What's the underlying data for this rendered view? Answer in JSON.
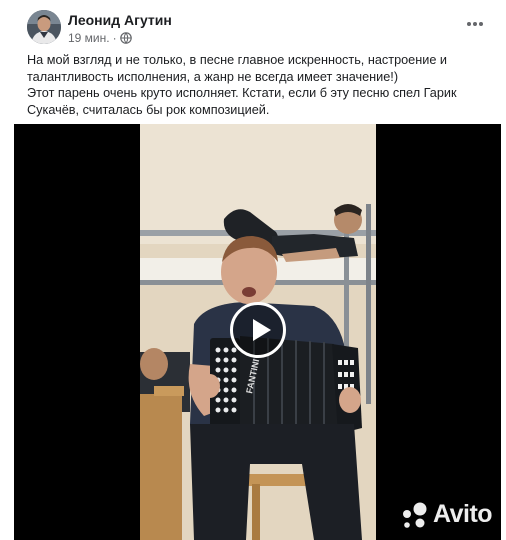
{
  "post": {
    "author": "Леонид Агутин",
    "time": "19 мин.",
    "separator": "·",
    "more_icon": "more-horizontal-icon",
    "privacy_icon": "globe-icon",
    "text": {
      "line1": "На мой взгляд и не только, в песне главное искренность, настроение и",
      "line2": "талантливость исполнения, а жанр не всегда имеет значение!)",
      "line3": "Этот парень очень круто исполняет. Кстати, если б эту песню спел Гарик",
      "line4": "Сукачёв, считалась бы рок композицией."
    }
  },
  "video": {
    "play_icon": "play-icon",
    "accordion_brand": "FANTINI"
  },
  "watermark": {
    "brand": "Avito"
  },
  "colors": {
    "text": "#1c1e21",
    "secondary": "#65676b",
    "video_bg": "#000000",
    "wall": "#e8ddc9"
  }
}
